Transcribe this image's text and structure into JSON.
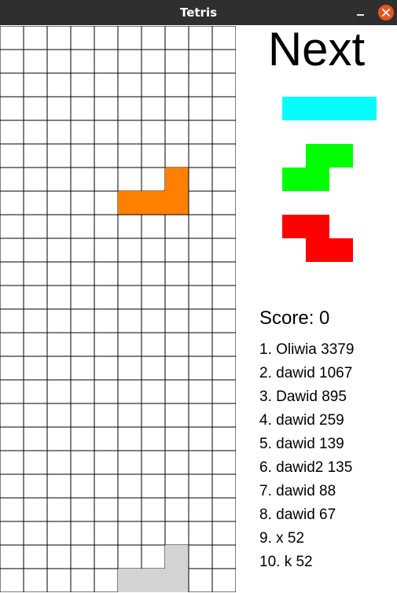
{
  "window": {
    "title": "Tetris"
  },
  "board": {
    "cols": 10,
    "rows": 24,
    "grid_color": "#000000",
    "empty_color": "#ffffff",
    "active_piece": {
      "type": "L",
      "color": "#ff8000",
      "cells": [
        [
          7,
          6
        ],
        [
          5,
          7
        ],
        [
          6,
          7
        ],
        [
          7,
          7
        ]
      ]
    },
    "locked_color": "#d3d3d3",
    "locked_cells": [
      [
        7,
        22
      ],
      [
        5,
        23
      ],
      [
        6,
        23
      ],
      [
        7,
        23
      ]
    ]
  },
  "next": {
    "title": "Next",
    "pieces": [
      {
        "type": "I",
        "color": "#00ffff",
        "cells": [
          [
            0,
            0
          ],
          [
            1,
            0
          ],
          [
            2,
            0
          ],
          [
            3,
            0
          ]
        ]
      },
      {
        "type": "S",
        "color": "#00ff00",
        "cells": [
          [
            1,
            0
          ],
          [
            2,
            0
          ],
          [
            0,
            1
          ],
          [
            1,
            1
          ]
        ]
      },
      {
        "type": "Z",
        "color": "#ff0000",
        "cells": [
          [
            0,
            0
          ],
          [
            1,
            0
          ],
          [
            1,
            1
          ],
          [
            2,
            1
          ]
        ]
      }
    ]
  },
  "score": {
    "label": "Score: 0"
  },
  "highscores": [
    "1. Oliwia 3379",
    "2. dawid 1067",
    "3. Dawid 895",
    "4. dawid 259",
    "5. dawid 139",
    "6. dawid2 135",
    "7. dawid 88",
    "8. dawid 67",
    "9. x 52",
    "10. k 52"
  ]
}
